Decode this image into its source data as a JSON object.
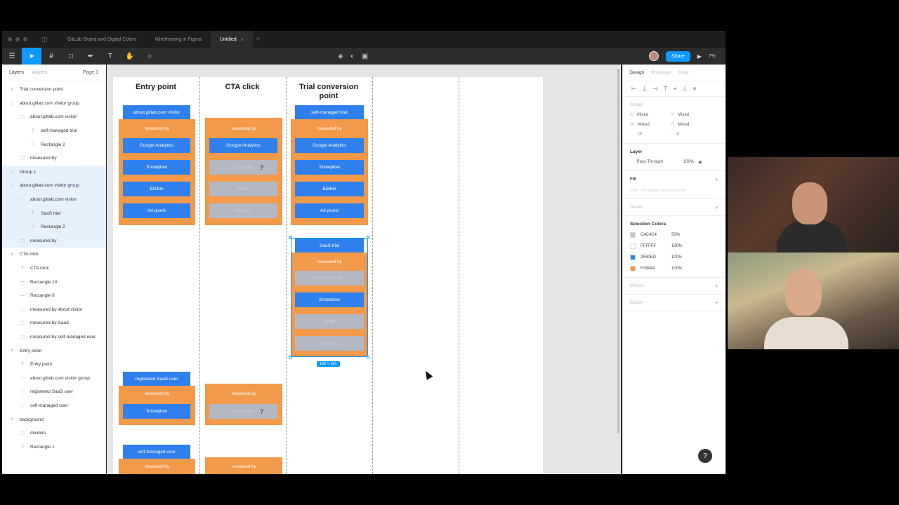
{
  "tabs": [
    {
      "label": "GitLab Brand and Digital Colors",
      "active": false
    },
    {
      "label": "Wireframing in Figma",
      "active": false
    },
    {
      "label": "Untitled",
      "active": true
    }
  ],
  "toolbar": {
    "share_label": "Share",
    "zoom": "7%"
  },
  "left_panel": {
    "tab_layers": "Layers",
    "tab_assets": "Assets",
    "page": "Page 1",
    "layers": [
      {
        "label": "Trial conversion point",
        "indent": 0,
        "icon": "frame-icon",
        "selected": false
      },
      {
        "label": "about.gitlab.com visitor group",
        "indent": 0,
        "icon": "group-icon",
        "selected": false
      },
      {
        "label": "about.gitlab.com visitor",
        "indent": 1,
        "icon": "group-icon",
        "selected": false
      },
      {
        "label": "self-managed trial",
        "indent": 2,
        "icon": "text-icon",
        "selected": false
      },
      {
        "label": "Rectangle 2",
        "indent": 2,
        "icon": "rect-icon",
        "selected": false
      },
      {
        "label": "measured by",
        "indent": 1,
        "icon": "group-icon",
        "selected": false
      },
      {
        "label": "Group 1",
        "indent": 0,
        "icon": "group-icon",
        "selected": true
      },
      {
        "label": "about.gitlab.com visitor group",
        "indent": 0,
        "icon": "group-icon",
        "selected": true
      },
      {
        "label": "about.gitlab.com visitor",
        "indent": 1,
        "icon": "group-icon",
        "selected": true
      },
      {
        "label": "SaaS trial",
        "indent": 2,
        "icon": "text-icon",
        "selected": true
      },
      {
        "label": "Rectangle 2",
        "indent": 2,
        "icon": "rect-icon",
        "selected": true
      },
      {
        "label": "measured by",
        "indent": 1,
        "icon": "group-icon",
        "selected": true
      },
      {
        "label": "CTA click",
        "indent": 0,
        "icon": "frame-icon",
        "selected": false
      },
      {
        "label": "CTA click",
        "indent": 1,
        "icon": "text-icon",
        "selected": false
      },
      {
        "label": "Rectangle 10",
        "indent": 1,
        "icon": "line-icon",
        "selected": false
      },
      {
        "label": "Rectangle 8",
        "indent": 1,
        "icon": "line-icon",
        "selected": false
      },
      {
        "label": "measured by about visitor",
        "indent": 1,
        "icon": "group-icon",
        "selected": false
      },
      {
        "label": "measured by SaaS",
        "indent": 1,
        "icon": "group-icon",
        "selected": false
      },
      {
        "label": "measured by self-managed user",
        "indent": 1,
        "icon": "group-icon",
        "selected": false
      },
      {
        "label": "Entry point",
        "indent": 0,
        "icon": "frame-icon",
        "selected": false
      },
      {
        "label": "Entry point",
        "indent": 1,
        "icon": "text-icon",
        "selected": false
      },
      {
        "label": "about.gitlab.com visitor group",
        "indent": 1,
        "icon": "group-icon",
        "selected": false
      },
      {
        "label": "registered SaaS user",
        "indent": 1,
        "icon": "group-icon",
        "selected": false
      },
      {
        "label": "self-managed user",
        "indent": 1,
        "icon": "group-icon",
        "selected": false
      },
      {
        "label": "background",
        "indent": 0,
        "icon": "frame-icon",
        "selected": false
      },
      {
        "label": "dividers",
        "indent": 1,
        "icon": "group-icon",
        "selected": false
      },
      {
        "label": "Rectangle 1",
        "indent": 1,
        "icon": "rect-icon",
        "selected": false
      }
    ]
  },
  "canvas": {
    "columns": [
      "Entry point",
      "CTA click",
      "Trial conversion point"
    ],
    "measured_by": "measured by",
    "blue_labels": {
      "entry_visitor": "about.gitlab.com visitor",
      "entry_registered": "registered SaaS user",
      "entry_selfmanaged": "self-managed user",
      "trial_selfmanaged": "self-managed trial",
      "trial_saas": "SaaS trial"
    },
    "tools": [
      "Google Analytics",
      "Snowplow",
      "Bizible",
      "Ad pixels"
    ],
    "question_mark": "?",
    "selection_size": "180 × 281"
  },
  "right_panel": {
    "tabs": [
      "Design",
      "Prototype",
      "Code"
    ],
    "group_title": "Group",
    "x_label": "X",
    "x_value": "Mixed",
    "y_label": "Y",
    "y_value": "Mixed",
    "w_label": "W",
    "w_value": "Mixed",
    "h_label": "H",
    "h_value": "Mixed",
    "rotation": "0°",
    "radius": "0",
    "layer_title": "Layer",
    "blend": "Pass Through",
    "opacity": "100%",
    "fill_title": "Fill",
    "fill_hint": "Click + to replace mixed content",
    "stroke_title": "Stroke",
    "selection_colors_title": "Selection Colors",
    "selection_colors": [
      {
        "hex": "C4C4C4",
        "opacity": "50%",
        "color": "#C4C4C4"
      },
      {
        "hex": "FFFFFF",
        "opacity": "100%",
        "color": "#FFFFFF"
      },
      {
        "hex": "2F80ED",
        "opacity": "100%",
        "color": "#2F80ED"
      },
      {
        "hex": "F2994A",
        "opacity": "100%",
        "color": "#F2994A"
      }
    ],
    "effects_title": "Effects",
    "export_title": "Export"
  },
  "help_label": "?",
  "colors": {
    "accent": "#0d99ff",
    "orange": "#f2994a",
    "blue": "#2f80ed",
    "gray": "#b4b8c2"
  }
}
